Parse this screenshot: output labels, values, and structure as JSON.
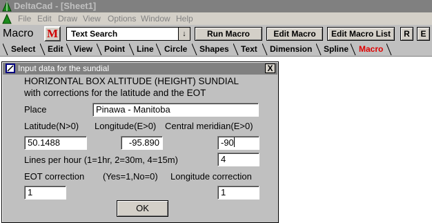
{
  "window": {
    "title": "DeltaCad - [Sheet1]"
  },
  "menu": [
    "File",
    "Edit",
    "Draw",
    "View",
    "Options",
    "Window",
    "Help"
  ],
  "toolbar": {
    "macro_label": "Macro",
    "m_button": "M",
    "macro_select": "Text Search",
    "dropdown_glyph": "↓",
    "run_macro": "Run Macro",
    "edit_macro": "Edit Macro",
    "edit_macro_list": "Edit Macro List",
    "r_button": "R",
    "e_button": "E"
  },
  "tabs": [
    "Select",
    "Edit",
    "View",
    "Point",
    "Line",
    "Circle",
    "Shapes",
    "Text",
    "Dimension",
    "Spline",
    "Macro"
  ],
  "dialog": {
    "title": "Input data for the sundial",
    "close": "X",
    "heading1": "HORIZONTAL BOX ALTITUDE (HEIGHT) SUNDIAL",
    "heading2": "with corrections for the latitude and the EOT",
    "place_label": "Place",
    "place_value": "Pinawa - Manitoba",
    "latitude_label": "Latitude(N>0)",
    "longitude_label": "Longitude(E>0)",
    "meridian_label": "Central meridian(E>0)",
    "latitude_value": "50.1488",
    "longitude_value": "-95.890",
    "meridian_value": "-90",
    "lines_label": "Lines per hour (1=1hr, 2=30m, 4=15m)",
    "lines_value": "4",
    "eot_label": "EOT correction",
    "yesno_label": "(Yes=1,No=0)",
    "longcorr_label": "Longitude correction",
    "eot_value": "1",
    "longcorr_value": "1",
    "ok": "OK"
  }
}
